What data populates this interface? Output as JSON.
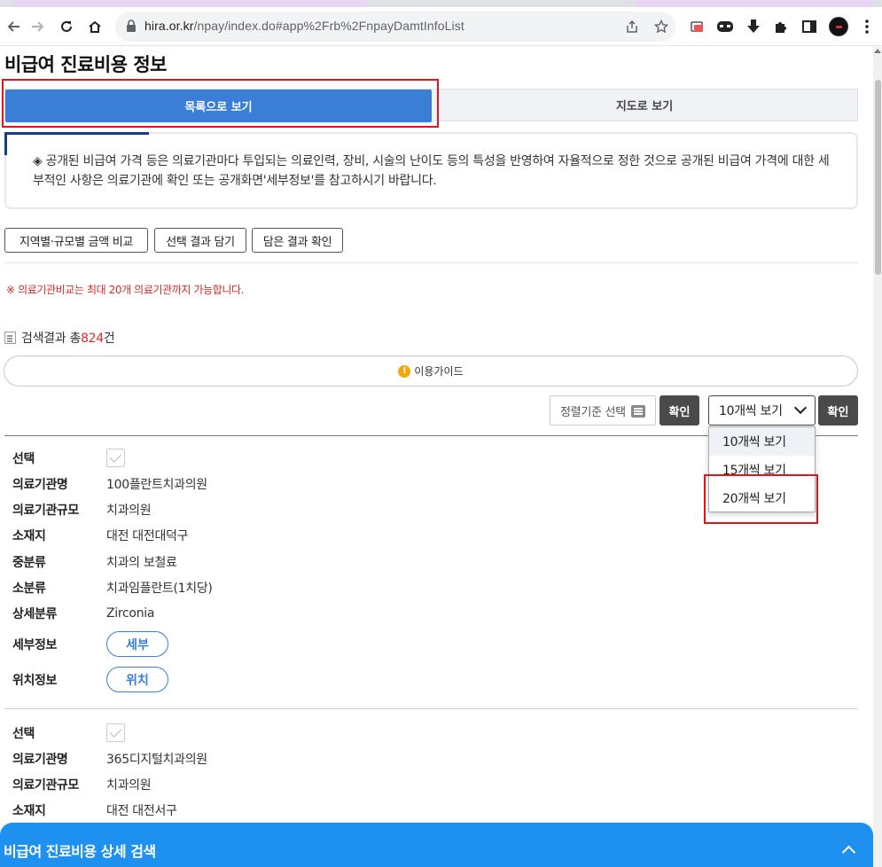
{
  "browser": {
    "url_host": "hira.or.kr",
    "url_path": "/npay/index.do#app%2Frb%2FnpayDamtInfoList"
  },
  "page": {
    "title": "비급여 진료비용 정보"
  },
  "tabs": {
    "list_view": "목록으로 보기",
    "map_view": "지도로 보기"
  },
  "notice": {
    "text": "◈ 공개된 비급여 가격 등은 의료기관마다 투입되는 의료인력, 장비, 시술의 난이도 등의 특성을 반영하여 자율적으로 정한 것으로 공개된 비급여 가격에 대한 세부적인 사항은 의료기관에 확인 또는 공개화면'세부정보'를 참고하시기 바랍니다."
  },
  "actions": {
    "compare": "지역별·규모별 금액 비교",
    "add_selection": "선택 결과 담기",
    "view_saved": "담은 결과 확인"
  },
  "warning": "※ 의료기관비교는 최대 20개 의료기관까지 가능합니다.",
  "results": {
    "prefix": "검색결과 총",
    "count": "824",
    "suffix": "건"
  },
  "guide": {
    "label": "이용가이드"
  },
  "sort": {
    "placeholder": "정렬기준 선택",
    "confirm": "확인"
  },
  "page_size": {
    "selected": "10개씩 보기",
    "confirm": "확인",
    "options": [
      "10개씩 보기",
      "15개씩 보기",
      "20개씩 보기"
    ]
  },
  "labels": {
    "select": "선택",
    "name": "의료기관명",
    "scale": "의료기관규모",
    "location": "소재지",
    "mid_category": "중분류",
    "sub_category": "소분류",
    "detail_category": "상세분류",
    "detail_info": "세부정보",
    "location_info": "위치정보",
    "detail_btn": "세부",
    "location_btn": "위치"
  },
  "records": [
    {
      "name": "100플란트치과의원",
      "scale": "치과의원",
      "location": "대전 대전대덕구",
      "mid_category": "치과의 보철료",
      "sub_category": "치과임플란트(1치당)",
      "detail_category": "Zirconia"
    },
    {
      "name": "365디지털치과의원",
      "scale": "치과의원",
      "location": "대전 대전서구"
    }
  ],
  "bottom_panel": {
    "title": "비급여 진료비용 상세 검색"
  },
  "colors": {
    "primary": "#3a7fd5",
    "highlight_red": "#e0141b",
    "warning_red": "#d62b2b",
    "bottom_bar": "#1e90f0"
  }
}
